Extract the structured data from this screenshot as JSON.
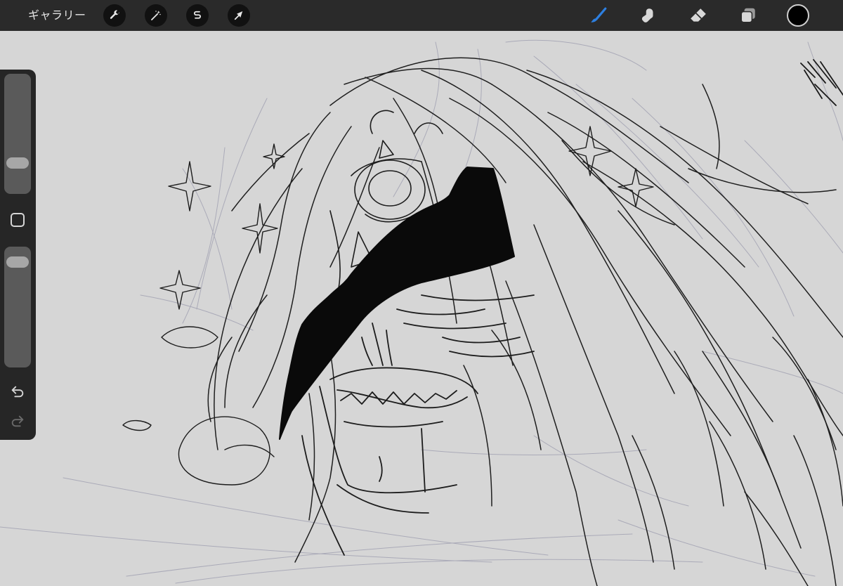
{
  "topbar": {
    "gallery_label": "ギャラリー",
    "left_tools": [
      {
        "name": "actions",
        "icon": "wrench-icon"
      },
      {
        "name": "adjustments",
        "icon": "magic-wand-icon"
      },
      {
        "name": "selection",
        "icon": "selection-s-icon"
      },
      {
        "name": "transform",
        "icon": "arrow-cursor-icon"
      }
    ],
    "right_tools": [
      {
        "name": "brush",
        "icon": "brush-icon",
        "active": true
      },
      {
        "name": "smudge",
        "icon": "smudge-icon",
        "active": false
      },
      {
        "name": "eraser",
        "icon": "eraser-icon",
        "active": false
      },
      {
        "name": "layers",
        "icon": "layers-icon",
        "active": false
      }
    ],
    "current_color": "#000000",
    "active_tool_color": "#2d7fe0"
  },
  "sidebar": {
    "brush_size_level": 0.22,
    "opacity_level": 0.93,
    "modify_button_icon": "square-icon",
    "undo_icon": "undo-icon",
    "redo_icon": "redo-icon",
    "redo_enabled": false
  },
  "canvas": {
    "background_color": "#d6d6d6",
    "content": "sketch-artwork"
  }
}
